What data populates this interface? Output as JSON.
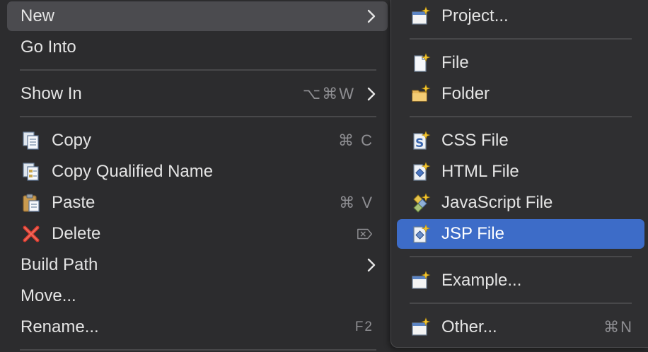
{
  "main_menu": {
    "new": {
      "label": "New"
    },
    "go_into": {
      "label": "Go Into"
    },
    "show_in": {
      "label": "Show In",
      "shortcut": "⌥⌘W"
    },
    "copy": {
      "label": "Copy",
      "shortcut": "⌘ C",
      "icon": "copy-icon"
    },
    "copy_qualified": {
      "label": "Copy Qualified Name",
      "icon": "copy-qualified-name-icon"
    },
    "paste": {
      "label": "Paste",
      "shortcut": "⌘ V",
      "icon": "paste-icon"
    },
    "delete": {
      "label": "Delete",
      "shortcut": "⌦",
      "icon": "delete-icon"
    },
    "build_path": {
      "label": "Build Path"
    },
    "move": {
      "label": "Move..."
    },
    "rename": {
      "label": "Rename...",
      "shortcut": "F2"
    }
  },
  "sub_menu": {
    "project": {
      "label": "Project...",
      "icon": "new-project-icon"
    },
    "file": {
      "label": "File",
      "icon": "new-file-icon"
    },
    "folder": {
      "label": "Folder",
      "icon": "new-folder-icon"
    },
    "css_file": {
      "label": "CSS File",
      "icon": "css-file-icon"
    },
    "html_file": {
      "label": "HTML File",
      "icon": "html-file-icon"
    },
    "js_file": {
      "label": "JavaScript File",
      "icon": "javascript-file-icon"
    },
    "jsp_file": {
      "label": "JSP File",
      "icon": "jsp-file-icon"
    },
    "example": {
      "label": "Example...",
      "icon": "example-icon"
    },
    "other": {
      "label": "Other...",
      "shortcut": "⌘N",
      "icon": "other-icon"
    }
  },
  "colors": {
    "menu_bg": "#2c2c2e",
    "hover_grey": "#4b4b4f",
    "selected_blue": "#3d6cc8",
    "text": "#e4e4e4",
    "shortcut_text": "#8e8e92"
  }
}
